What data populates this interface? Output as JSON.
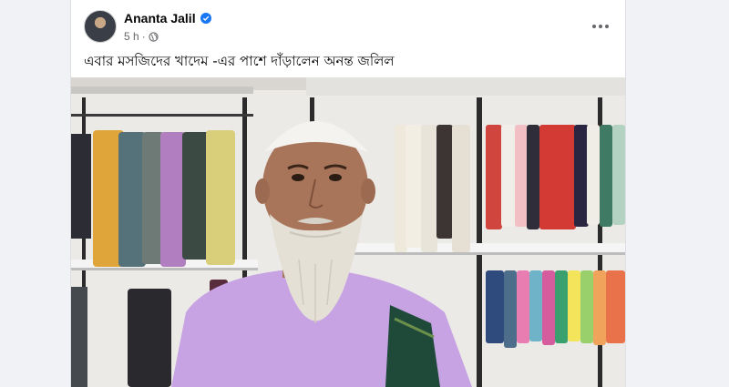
{
  "post": {
    "author": "Ananta Jalil",
    "time": "5 h",
    "separator": "·",
    "privacy_icon": "globe-icon",
    "verified_icon": "verified-badge-icon",
    "more_icon": "more-options-icon",
    "caption": "এবার মসজিদের খাদেম -এর পাশে দাঁড়ালেন অনন্ত জলিল"
  },
  "colors": {
    "page_bg": "#f0f2f5",
    "card_bg": "#ffffff",
    "verified": "#1877f2",
    "meta_text": "#65676b"
  }
}
